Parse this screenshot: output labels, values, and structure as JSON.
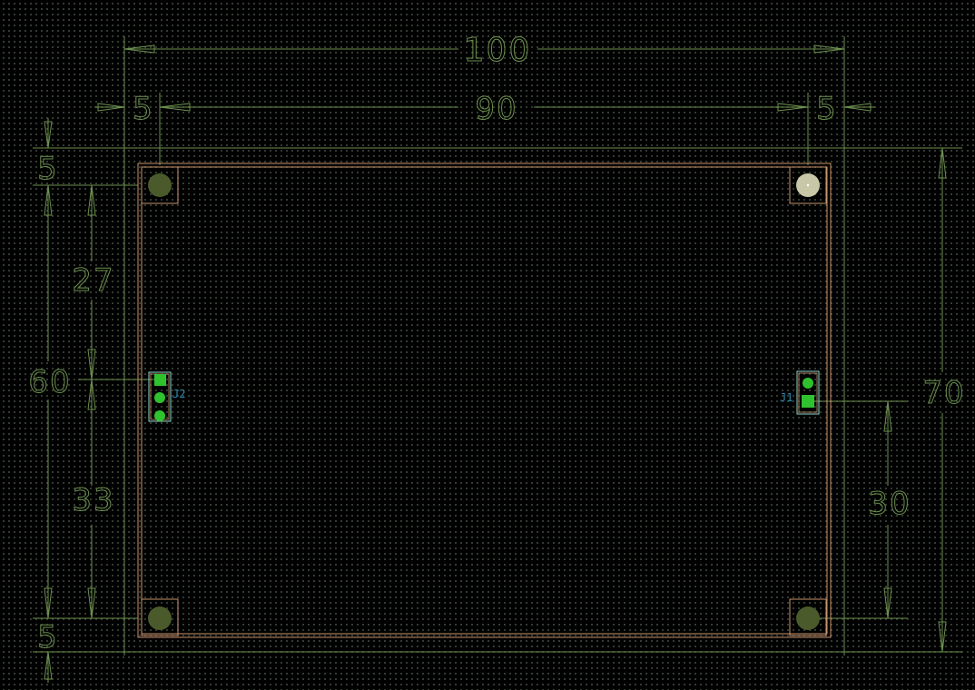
{
  "colors": {
    "background": "#000000",
    "grid": "#3f4a40",
    "dimension": "#6b8f4e",
    "board_edge": "#c9956c",
    "mounting_hole": "#4a5a2a",
    "mounting_hole_selected": "#c8c8a8",
    "pad": "#2fc22f",
    "silkscreen": "#8fd8d0",
    "reference": "#2a8ab0"
  },
  "board": {
    "width_label": "100",
    "inner_width_label": "90",
    "left_margin_label": "5",
    "right_margin_label": "5",
    "height_label": "70",
    "inner_height_label": "60",
    "top_margin_label": "5",
    "bottom_margin_label": "5",
    "j2_upper_label": "27",
    "j2_lower_label": "33",
    "j1_offset_label": "30"
  },
  "components": {
    "j2": {
      "ref": "J2",
      "pins": 3
    },
    "j1": {
      "ref": "J1",
      "pins": 2
    }
  },
  "mounting_holes": [
    {
      "name": "top-left",
      "selected": false
    },
    {
      "name": "top-right",
      "selected": true
    },
    {
      "name": "bottom-left",
      "selected": false
    },
    {
      "name": "bottom-right",
      "selected": false
    }
  ]
}
